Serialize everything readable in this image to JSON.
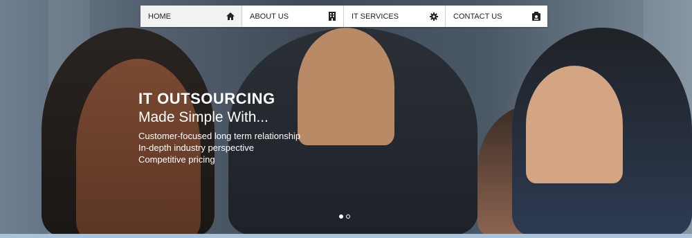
{
  "nav": {
    "items": [
      {
        "label": "HOME",
        "icon": "home-icon",
        "active": true
      },
      {
        "label": "ABOUT US",
        "icon": "building-icon",
        "active": false
      },
      {
        "label": "IT SERVICES",
        "icon": "gear-icon",
        "active": false
      },
      {
        "label": "CONTACT US",
        "icon": "contact-card-icon",
        "active": false
      }
    ]
  },
  "slide": {
    "title": "IT OUTSOURCING",
    "subtitle": "Made Simple With...",
    "bullets": [
      "Customer-focused long term relationship",
      "In-depth industry perspective",
      "Competitive pricing"
    ]
  },
  "carousel": {
    "count": 2,
    "active_index": 0
  },
  "colors": {
    "bottom_bar": "#a9c3dc",
    "nav_bg": "#ffffff",
    "text_light": "#ffffff"
  }
}
